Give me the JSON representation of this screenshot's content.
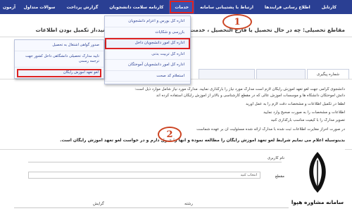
{
  "navbar": {
    "items": [
      {
        "label": "کارتابل"
      },
      {
        "label": "اطلاع رسانی فرایندها"
      },
      {
        "label": "ارتباط با پشتیبانی سامانه"
      },
      {
        "label": "خدمات"
      },
      {
        "label": "کارنامه سلامت دانشجویان"
      },
      {
        "label": "گزارش پرداخت"
      },
      {
        "label": "سوالات متداول"
      }
    ],
    "left_label": "آزمون"
  },
  "page_title": "مقاطع تحصیلی: چه در حال تحصیل یا فارغ التحصیل ، خدمت مورد نظر خود را مشاهده نمی کنید،از تکمیل بودن اطلاعات",
  "services_menu": {
    "items": [
      {
        "label": "اداره کل بورس و اعزام دانشجویان"
      },
      {
        "label": "بازرسی و شکایات"
      },
      {
        "label": "اداره کل امور دانشجویان داخل"
      },
      {
        "label": "اداره کل تربیت بدنی"
      },
      {
        "label": "اداره کل امور دانشجویان آموختگان"
      },
      {
        "label": "استعلام کد صحت"
      }
    ]
  },
  "submenu": {
    "items": [
      {
        "label": "صدور گواهی اشتغال به تحصیل"
      },
      {
        "label": "تایید مدارک تحصیلی دانشگاهی داخل کشور جهت ترجمه رسمی"
      },
      {
        "label": "لغو تعهد آموزش رایگان"
      }
    ]
  },
  "steps": {
    "one": "1",
    "two": "2"
  },
  "tabs": [
    {
      "label": "شماره پیگیری"
    },
    {
      "label": ""
    },
    {
      "label": ""
    }
  ],
  "body": {
    "p1": "دانشجوی گرامی جهت لغو تعهد آموزش رایگان لازم است مدارک مورد نیاز را بارگذاری نمایید. مدارک مورد نیاز شامل موارد ذیل است:",
    "p2": "دانش آموختگان دانشگاه ها و موسسات آموزش عالی که در مقطع کارشناسی و بالاتر از آموزش رایگان استفاده کرده اند",
    "p3": "لطفاً در تکمیل اطلاعات و مشخصات دقت لازم را به عمل آورید",
    "p4": "اطلاعات و مشخصات را به صورت صحیح وارد نمایید",
    "p5": "تصویر مدارک را با کیفیت مناسب بارگذاری کنید",
    "p6": "در صورت احراز مغایرت اطلاعات ثبت شده با مدارک ارائه شده مسئولیت آن بر عهده شماست",
    "bold": "بدینوسیله اعلام می نمایم شرایط لغو تعهد آموزش رایگان را مطالعه نموده و آنها را قبول دارم و در خواست لغو تعهد آموزش رایگان است."
  },
  "form": {
    "field1_label": "نام کاربری",
    "field2_label": "رشته",
    "field3_label": "گرایش",
    "select_placeholder": "انتخاب کنید",
    "row_label": "مقطع"
  },
  "logo": {
    "text": "سامانه مشاوره هپوا"
  },
  "colors": {
    "navbar": "#2a3f93",
    "highlight": "#dd2222",
    "step_circle": "#cc4422"
  }
}
